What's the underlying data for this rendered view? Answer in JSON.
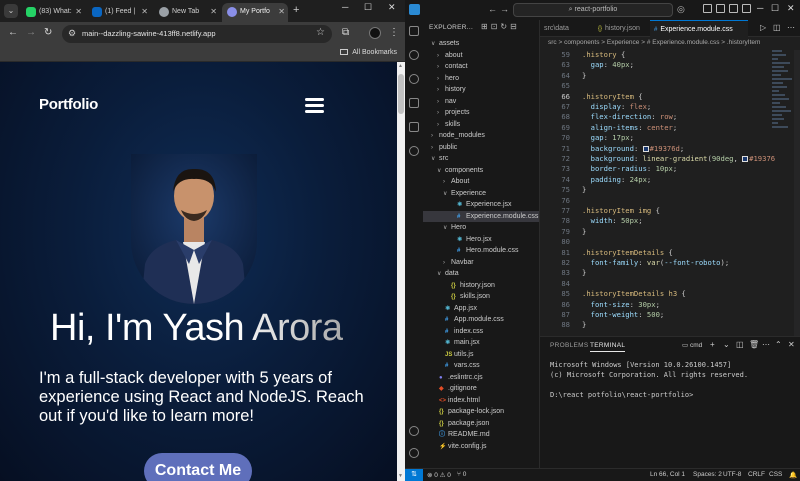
{
  "browser": {
    "tabs": [
      {
        "label": "(83) What:",
        "color": "#25d366"
      },
      {
        "label": "(1) Feed |",
        "color": "#0a66c2"
      },
      {
        "label": "New Tab",
        "color": "#9aa0a6"
      },
      {
        "label": "My Portfo",
        "color": "#8a8fe8"
      }
    ],
    "url": "main--dazzling-sawine-413ff8.netlify.app",
    "bookmarks_label": "All Bookmarks"
  },
  "site": {
    "logo": "Portfolio",
    "headline": "Hi, I'm Yash Arora",
    "intro": "I'm a full-stack developer with 5 years of experience using React and NodeJS. Reach out if you'd like to learn more!",
    "cta": "Contact Me"
  },
  "vscode": {
    "search": "react-portfolio",
    "explorer_title": "EXPLORER...",
    "tree": [
      {
        "label": "assets",
        "depth": 0,
        "chev": "∨",
        "icon": ""
      },
      {
        "label": "about",
        "depth": 1,
        "chev": "›",
        "icon": ""
      },
      {
        "label": "contact",
        "depth": 1,
        "chev": "›",
        "icon": ""
      },
      {
        "label": "hero",
        "depth": 1,
        "chev": "›",
        "icon": ""
      },
      {
        "label": "history",
        "depth": 1,
        "chev": "›",
        "icon": ""
      },
      {
        "label": "nav",
        "depth": 1,
        "chev": "›",
        "icon": ""
      },
      {
        "label": "projects",
        "depth": 1,
        "chev": "›",
        "icon": ""
      },
      {
        "label": "skills",
        "depth": 1,
        "chev": "›",
        "icon": ""
      },
      {
        "label": "node_modules",
        "depth": 0,
        "chev": "›",
        "icon": ""
      },
      {
        "label": "public",
        "depth": 0,
        "chev": "›",
        "icon": ""
      },
      {
        "label": "src",
        "depth": 0,
        "chev": "∨",
        "icon": ""
      },
      {
        "label": "components",
        "depth": 1,
        "chev": "∨",
        "icon": ""
      },
      {
        "label": "About",
        "depth": 2,
        "chev": "›",
        "icon": ""
      },
      {
        "label": "Experience",
        "depth": 2,
        "chev": "∨",
        "icon": ""
      },
      {
        "label": "Experience.jsx",
        "depth": 3,
        "chev": "",
        "icon": "⚛"
      },
      {
        "label": "Experience.module.css",
        "depth": 3,
        "chev": "",
        "icon": "#"
      },
      {
        "label": "Hero",
        "depth": 2,
        "chev": "∨",
        "icon": ""
      },
      {
        "label": "Hero.jsx",
        "depth": 3,
        "chev": "",
        "icon": "⚛"
      },
      {
        "label": "Hero.module.css",
        "depth": 3,
        "chev": "",
        "icon": "#"
      },
      {
        "label": "Navbar",
        "depth": 2,
        "chev": "›",
        "icon": ""
      },
      {
        "label": "data",
        "depth": 1,
        "chev": "∨",
        "icon": ""
      },
      {
        "label": "history.json",
        "depth": 2,
        "chev": "",
        "icon": "{}"
      },
      {
        "label": "skills.json",
        "depth": 2,
        "chev": "",
        "icon": "{}"
      },
      {
        "label": "App.jsx",
        "depth": 1,
        "chev": "",
        "icon": "⚛"
      },
      {
        "label": "App.module.css",
        "depth": 1,
        "chev": "",
        "icon": "#"
      },
      {
        "label": "index.css",
        "depth": 1,
        "chev": "",
        "icon": "#"
      },
      {
        "label": "main.jsx",
        "depth": 1,
        "chev": "",
        "icon": "⚛"
      },
      {
        "label": "utils.js",
        "depth": 1,
        "chev": "",
        "icon": "JS"
      },
      {
        "label": "vars.css",
        "depth": 1,
        "chev": "",
        "icon": "#"
      },
      {
        "label": ".eslintrc.cjs",
        "depth": 0,
        "chev": "",
        "icon": "●"
      },
      {
        "label": ".gitignore",
        "depth": 0,
        "chev": "",
        "icon": "◆"
      },
      {
        "label": "index.html",
        "depth": 0,
        "chev": "",
        "icon": "<>"
      },
      {
        "label": "package-lock.json",
        "depth": 0,
        "chev": "",
        "icon": "{}"
      },
      {
        "label": "package.json",
        "depth": 0,
        "chev": "",
        "icon": "{}"
      },
      {
        "label": "README.md",
        "depth": 0,
        "chev": "",
        "icon": "ⓘ"
      },
      {
        "label": "vite.config.js",
        "depth": 0,
        "chev": "",
        "icon": "⚡"
      }
    ],
    "editor_tabs": [
      {
        "label": "src\\data",
        "icon": ""
      },
      {
        "label": "history.json",
        "icon": "{}"
      },
      {
        "label": "Experience.module.css",
        "icon": "#"
      }
    ],
    "breadcrumb": "src > components > Experience > # Experience.module.css > .historyItem",
    "code": [
      {
        "n": "59",
        "t": [
          [
            "sel-c",
            ".history"
          ],
          [
            "pun",
            " {"
          ]
        ]
      },
      {
        "n": "63",
        "t": [
          [
            "prop",
            "  gap"
          ],
          [
            "pun",
            ": "
          ],
          [
            "num",
            "40px"
          ],
          [
            "pun",
            ";"
          ]
        ]
      },
      {
        "n": "64",
        "t": [
          [
            "pun",
            "}"
          ]
        ]
      },
      {
        "n": "65",
        "t": []
      },
      {
        "n": "66",
        "t": [
          [
            "sel-c",
            ".historyItem"
          ],
          [
            "pun",
            " {"
          ]
        ]
      },
      {
        "n": "67",
        "t": [
          [
            "prop",
            "  display"
          ],
          [
            "pun",
            ": "
          ],
          [
            "val",
            "flex"
          ],
          [
            "pun",
            ";"
          ]
        ]
      },
      {
        "n": "68",
        "t": [
          [
            "prop",
            "  flex-direction"
          ],
          [
            "pun",
            ": "
          ],
          [
            "val",
            "row"
          ],
          [
            "pun",
            ";"
          ]
        ]
      },
      {
        "n": "69",
        "t": [
          [
            "prop",
            "  align-items"
          ],
          [
            "pun",
            ": "
          ],
          [
            "val",
            "center"
          ],
          [
            "pun",
            ";"
          ]
        ]
      },
      {
        "n": "70",
        "t": [
          [
            "prop",
            "  gap"
          ],
          [
            "pun",
            ": "
          ],
          [
            "num",
            "17px"
          ],
          [
            "pun",
            ";"
          ]
        ]
      },
      {
        "n": "71",
        "t": [
          [
            "prop",
            "  background"
          ],
          [
            "pun",
            ": "
          ],
          [
            "swatch",
            "#19376d"
          ],
          [
            "val",
            "#19376d"
          ],
          [
            "pun",
            ";"
          ]
        ]
      },
      {
        "n": "72",
        "t": [
          [
            "prop",
            "  background"
          ],
          [
            "pun",
            ": "
          ],
          [
            "fn",
            "linear-gradient"
          ],
          [
            "pun",
            "("
          ],
          [
            "num",
            "90deg"
          ],
          [
            "pun",
            ", "
          ],
          [
            "swatch",
            "#19376d"
          ],
          [
            "val",
            "#19376"
          ]
        ]
      },
      {
        "n": "73",
        "t": [
          [
            "prop",
            "  border-radius"
          ],
          [
            "pun",
            ": "
          ],
          [
            "num",
            "10px"
          ],
          [
            "pun",
            ";"
          ]
        ]
      },
      {
        "n": "74",
        "t": [
          [
            "prop",
            "  padding"
          ],
          [
            "pun",
            ": "
          ],
          [
            "num",
            "24px"
          ],
          [
            "pun",
            ";"
          ]
        ]
      },
      {
        "n": "75",
        "t": [
          [
            "pun",
            "}"
          ]
        ]
      },
      {
        "n": "76",
        "t": []
      },
      {
        "n": "77",
        "t": [
          [
            "sel-c",
            ".historyItem img"
          ],
          [
            "pun",
            " {"
          ]
        ]
      },
      {
        "n": "78",
        "t": [
          [
            "prop",
            "  width"
          ],
          [
            "pun",
            ": "
          ],
          [
            "num",
            "50px"
          ],
          [
            "pun",
            ";"
          ]
        ]
      },
      {
        "n": "79",
        "t": [
          [
            "pun",
            "}"
          ]
        ]
      },
      {
        "n": "80",
        "t": []
      },
      {
        "n": "81",
        "t": [
          [
            "sel-c",
            ".historyItemDetails"
          ],
          [
            "pun",
            " {"
          ]
        ]
      },
      {
        "n": "82",
        "t": [
          [
            "prop",
            "  font-family"
          ],
          [
            "pun",
            ": "
          ],
          [
            "fn",
            "var"
          ],
          [
            "pun",
            "("
          ],
          [
            "prop",
            "--font-roboto"
          ],
          [
            "pun",
            ");"
          ]
        ]
      },
      {
        "n": "83",
        "t": [
          [
            "pun",
            "}"
          ]
        ]
      },
      {
        "n": "84",
        "t": []
      },
      {
        "n": "85",
        "t": [
          [
            "sel-c",
            ".historyItemDetails h3"
          ],
          [
            "pun",
            " {"
          ]
        ]
      },
      {
        "n": "86",
        "t": [
          [
            "prop",
            "  font-size"
          ],
          [
            "pun",
            ": "
          ],
          [
            "num",
            "30px"
          ],
          [
            "pun",
            ";"
          ]
        ]
      },
      {
        "n": "87",
        "t": [
          [
            "prop",
            "  font-weight"
          ],
          [
            "pun",
            ": "
          ],
          [
            "num",
            "500"
          ],
          [
            "pun",
            ";"
          ]
        ]
      },
      {
        "n": "88",
        "t": [
          [
            "pun",
            "}"
          ]
        ]
      }
    ],
    "current_line": "66",
    "panel_tabs": [
      "PROBLEMS",
      "TERMINAL"
    ],
    "terminal_shell": "cmd",
    "terminal_lines": [
      "Microsoft Windows [Version 10.0.26100.1457]",
      "(c) Microsoft Corporation. All rights reserved.",
      "",
      "D:\\react potfolio\\react-portfolio>"
    ],
    "status": {
      "problems": "⊗ 0 ⚠ 0",
      "ports": "⑂ 0",
      "position": "Ln 66, Col 1",
      "spaces": "Spaces: 2",
      "encoding": "UTF-8",
      "eol": "CRLF",
      "language": "CSS"
    }
  }
}
